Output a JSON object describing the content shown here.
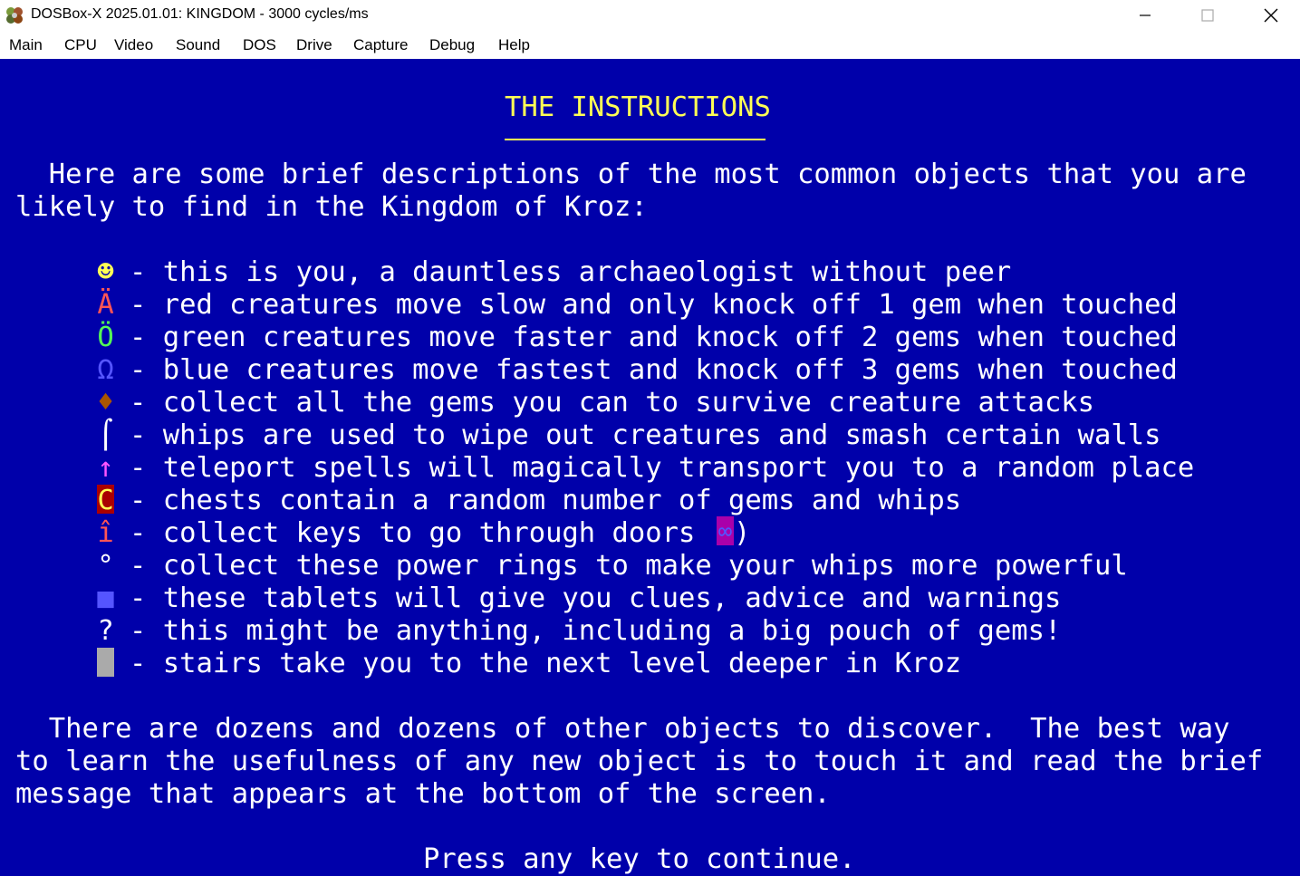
{
  "window": {
    "title": "DOSBox-X 2025.01.01: KINGDOM - 3000 cycles/ms",
    "icon": "dosbox-x-app-icon",
    "controls": [
      "minimize-icon",
      "maximize-icon",
      "close-icon"
    ]
  },
  "menu": [
    "Main",
    "CPU",
    "Video",
    "Sound",
    "DOS",
    "Drive",
    "Capture",
    "Debug",
    "Help"
  ],
  "screen": {
    "heading": "THE INSTRUCTIONS",
    "intro_line1": "  Here are some brief descriptions of the most common objects that you are",
    "intro_line2": "likely to find in the Kingdom of Kroz:",
    "legend": [
      {
        "symbol": "☻",
        "text": "- this is you, a dauntless archaeologist without peer",
        "color": "#ffff55"
      },
      {
        "symbol": "Ä",
        "text": "- red creatures move slow and only knock off 1 gem when touched",
        "color": "#ff5555"
      },
      {
        "symbol": "Ö",
        "text": "- green creatures move faster and knock off 2 gems when touched",
        "color": "#55ff55"
      },
      {
        "symbol": "Ω",
        "text": "- blue creatures move fastest and knock off 3 gems when touched",
        "color": "#5555ff"
      },
      {
        "symbol": "♦",
        "text": "- collect all the gems you can to survive creature attacks",
        "color": "#aa5500"
      },
      {
        "symbol": "⌠",
        "text": "- whips are used to wipe out creatures and smash certain walls",
        "color": "#ffffff"
      },
      {
        "symbol": "↑",
        "text": "- teleport spells will magically transport you to a random place",
        "color": "#ff55ff"
      },
      {
        "symbol": "C",
        "text": "- chests contain a random number of gems and whips",
        "color": "#ffff55"
      },
      {
        "symbol": "î",
        "text": "- collect keys to go through doors (",
        "color": "#ff5555"
      },
      {
        "symbol": "°",
        "text": "- collect these power rings to make your whips more powerful",
        "color": "#ffffff"
      },
      {
        "symbol": "■",
        "text": "- these tablets will give you clues, advice and warnings",
        "color": "#5555ff"
      },
      {
        "symbol": "?",
        "text": "- this might be anything, including a big pouch of gems!",
        "color": "#ffffff"
      },
      {
        "symbol": " ",
        "text": "- stairs take you to the next level deeper in Kroz",
        "color": "#aaaaaa"
      }
    ],
    "door_symbol": "∞",
    "door_close": ")",
    "outro_line1": "  There are dozens and dozens of other objects to discover.  The best way",
    "outro_line2": "to learn the usefulness of any new object is to touch it and read the brief",
    "outro_line3": "message that appears at the bottom of the screen.",
    "prompt": "Press any key to continue."
  }
}
